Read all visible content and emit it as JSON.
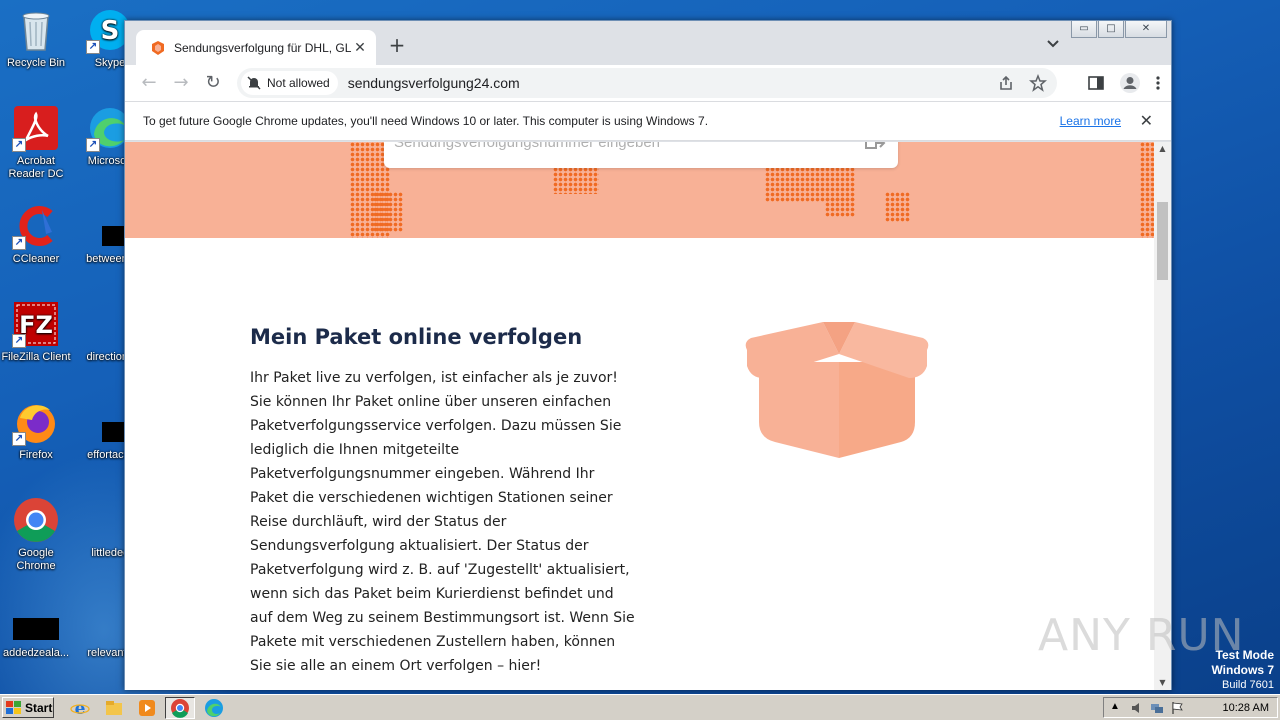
{
  "desktop": {
    "icons": [
      {
        "label": "Recycle Bin",
        "icon": "recycle-bin-icon"
      },
      {
        "label": "Skype",
        "icon": "skype-icon"
      },
      {
        "label": "Acrobat Reader DC",
        "icon": "acrobat-icon"
      },
      {
        "label": "Microsoft",
        "icon": "edge-icon"
      },
      {
        "label": "CCleaner",
        "icon": "ccleaner-icon"
      },
      {
        "label": "betweeng",
        "icon": "black-file-icon"
      },
      {
        "label": "FileZilla Client",
        "icon": "filezilla-icon"
      },
      {
        "label": "directions",
        "icon": "blank-file-icon"
      },
      {
        "label": "Firefox",
        "icon": "firefox-icon"
      },
      {
        "label": "effortacth",
        "icon": "black-file-icon"
      },
      {
        "label": "Google Chrome",
        "icon": "chrome-icon"
      },
      {
        "label": "littledec",
        "icon": "blank-file-icon"
      },
      {
        "label": "addedzeala...",
        "icon": "black-file-icon"
      },
      {
        "label": "relevante",
        "icon": "blank-file-icon"
      }
    ],
    "test_mode": {
      "line1": "Test Mode",
      "line2": "Windows 7",
      "line3": "Build 7601"
    },
    "watermark": "ANY RUN"
  },
  "browser": {
    "tab_title": "Sendungsverfolgung für DHL, GLS, U",
    "tab_close": "✕",
    "new_tab": "+",
    "window_controls": {
      "minimize": "▭",
      "maximize": "□",
      "close": "✕"
    },
    "nav": {
      "back": "←",
      "forward": "→",
      "reload": "↻"
    },
    "site_chip": "Not allowed",
    "url": "sendungsverfolgung24.com",
    "infobar": {
      "text": "To get future Google Chrome updates, you'll need Windows 10 or later. This computer is using Windows 7.",
      "link": "Learn more",
      "close": "✕"
    }
  },
  "page": {
    "search_placeholder": "Sendungsverfolgungsnummer eingeben",
    "heading": "Mein Paket online verfolgen",
    "paragraph": "Ihr Paket live zu verfolgen, ist einfacher als je zuvor! Sie können Ihr Paket online über unseren einfachen Paketverfolgungsservice verfolgen. Dazu müssen Sie lediglich die Ihnen mitgeteilte Paketverfolgungsnummer eingeben. Während Ihr Paket die verschiedenen wichtigen Stationen seiner Reise durchläuft, wird der Status der Sendungsverfolgung aktualisiert. Der Status der Paketverfolgung wird z. B. auf 'Zugestellt' aktualisiert, wenn sich das Paket beim Kurierdienst befindet und auf dem Weg zu seinem Bestimmungsort ist. Wenn Sie Pakete mit verschiedenen Zustellern haben, können Sie sie alle an einem Ort verfolgen – hier!",
    "colors": {
      "hero_bg": "#f8b196",
      "dots": "#f06a22",
      "box": "#f8b196",
      "heading": "#1c2b4a"
    }
  },
  "taskbar": {
    "start_label": "Start",
    "clock": "10:28 AM",
    "apps": [
      "ie-icon",
      "explorer-icon",
      "media-player-icon",
      "chrome-icon",
      "edge-icon"
    ]
  }
}
